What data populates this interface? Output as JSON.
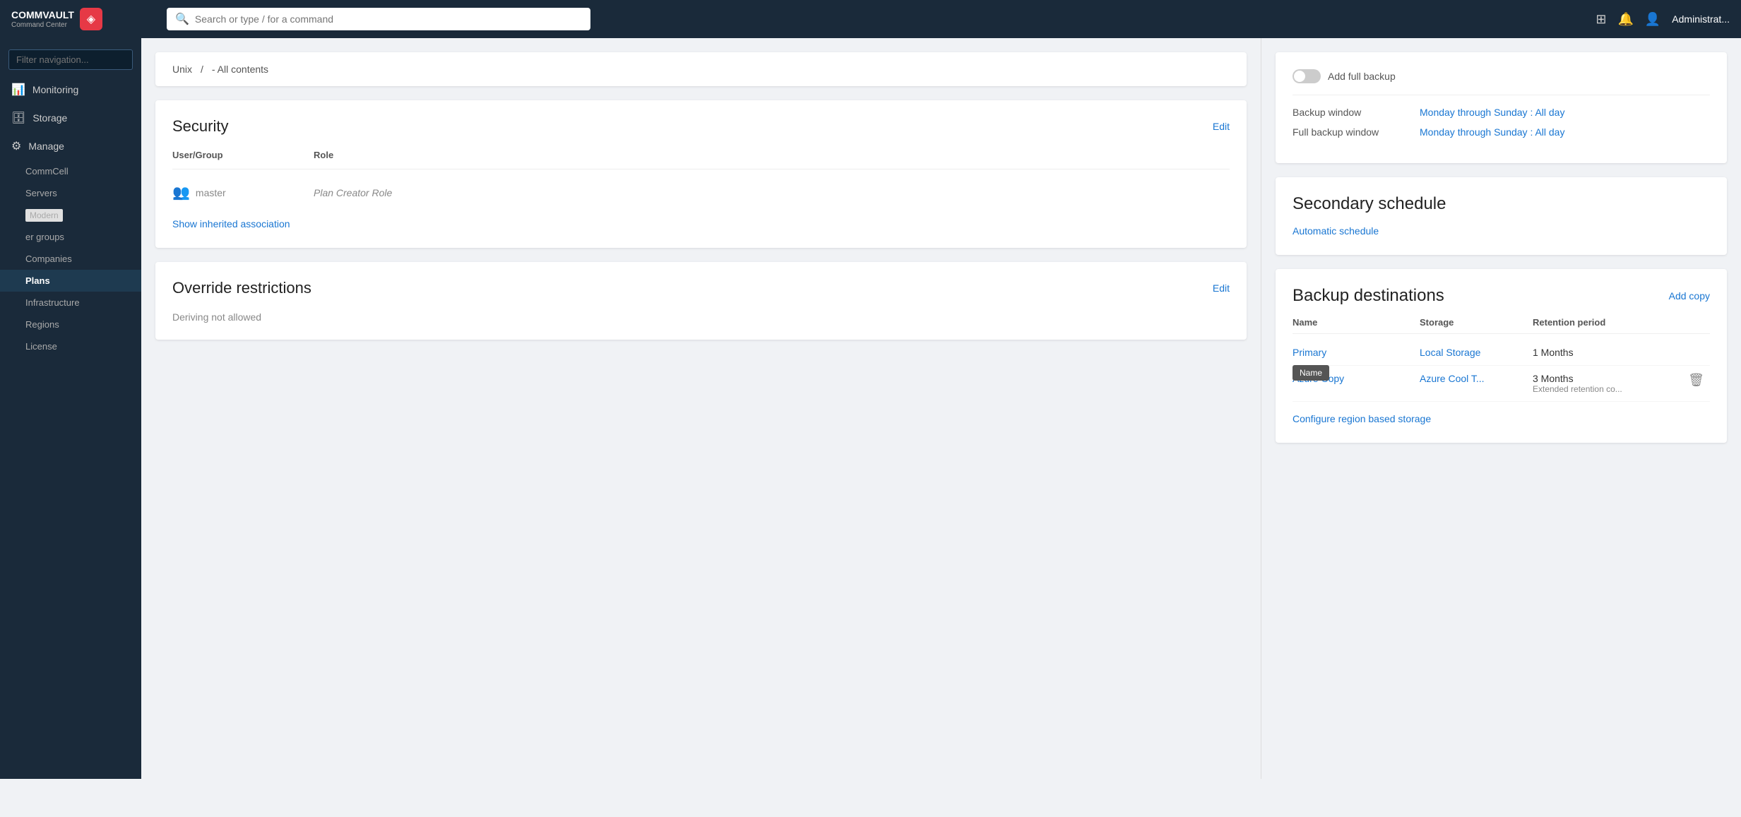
{
  "topbar": {
    "logo_line1": "COMMVAULT",
    "logo_line2": "Command Center",
    "search_placeholder": "Search or type / for a command",
    "admin_label": "Administrat..."
  },
  "sidebar": {
    "filter_placeholder": "Filter navigation...",
    "items": [
      {
        "id": "monitoring",
        "label": "Monitoring",
        "icon": "📊"
      },
      {
        "id": "storage",
        "label": "Storage",
        "icon": "🗄"
      },
      {
        "id": "manage",
        "label": "Manage",
        "icon": "⚙"
      },
      {
        "id": "commcell",
        "label": "CommCell",
        "sub": true
      },
      {
        "id": "servers",
        "label": "Servers",
        "sub": true
      },
      {
        "id": "modern",
        "label": "Modern",
        "sub": true,
        "badge": true
      },
      {
        "id": "er-groups",
        "label": "er groups",
        "sub": true
      },
      {
        "id": "companies",
        "label": "Companies",
        "sub": true
      },
      {
        "id": "plans",
        "label": "Plans",
        "sub": true,
        "active": true
      },
      {
        "id": "infrastructure",
        "label": "Infrastructure",
        "sub": true
      },
      {
        "id": "regions",
        "label": "Regions",
        "sub": true
      },
      {
        "id": "license",
        "label": "License",
        "sub": true
      }
    ]
  },
  "left_panel": {
    "unix_row": {
      "label": "Unix",
      "separator": "/",
      "value": "- All contents"
    },
    "security": {
      "title": "Security",
      "edit_label": "Edit",
      "col_user": "User/Group",
      "col_role": "Role",
      "row": {
        "user": "master",
        "role": "Plan Creator Role"
      },
      "show_inherited": "Show inherited association"
    },
    "override": {
      "title": "Override restrictions",
      "edit_label": "Edit",
      "text": "Deriving not allowed"
    }
  },
  "right_panel": {
    "add_full_backup_label": "Add full backup",
    "backup_window_label": "Backup window",
    "backup_window_value": "Monday through Sunday : All day",
    "full_backup_window_label": "Full backup window",
    "full_backup_window_value": "Monday through Sunday : All day",
    "secondary_schedule": {
      "title": "Secondary schedule",
      "link": "Automatic schedule"
    },
    "backup_destinations": {
      "title": "Backup destinations",
      "add_copy_label": "Add copy",
      "col_name": "Name",
      "col_storage": "Storage",
      "col_retention": "Retention period",
      "name_tooltip": "Name",
      "rows": [
        {
          "name": "Primary",
          "storage": "Local Storage",
          "retention": "1 Months",
          "retention_sub": "",
          "has_delete": false
        },
        {
          "name": "Azure Copy",
          "storage": "Azure Cool T...",
          "retention": "3 Months",
          "retention_sub": "Extended retention co...",
          "has_delete": true
        }
      ],
      "configure_region": "Configure region based storage"
    }
  }
}
